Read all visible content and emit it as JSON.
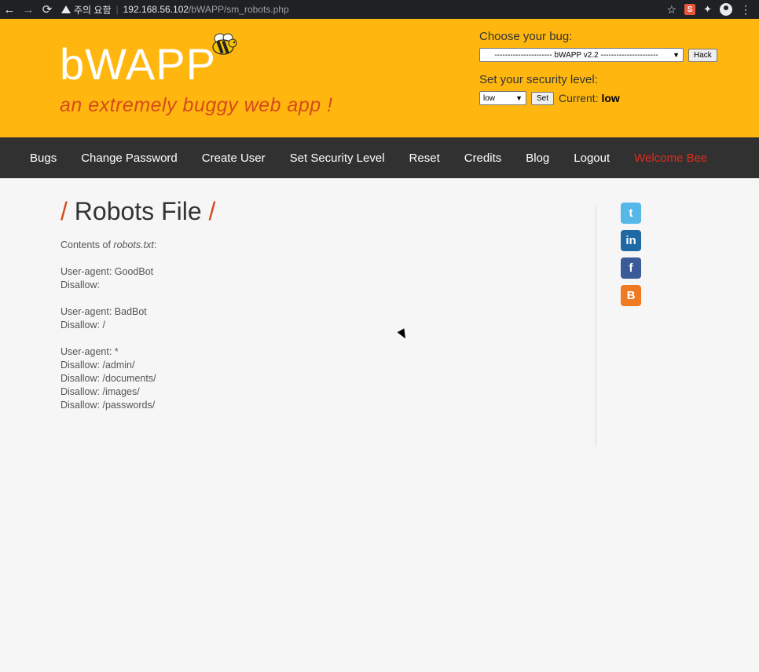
{
  "browser": {
    "warning_label": "주의 요함",
    "url_host": "192.168.56.102",
    "url_path": "/bWAPP/sm_robots.php"
  },
  "header": {
    "logo": "bWAPP",
    "tagline": "an extremely buggy web app !",
    "choose_bug_label": "Choose your bug:",
    "bug_select_value": "---------------------- bWAPP v2.2 ----------------------",
    "hack_button": "Hack",
    "security_label": "Set your security level:",
    "security_select_value": "low",
    "set_button": "Set",
    "current_label": "Current:",
    "current_value": "low",
    "colors": {
      "header_bg": "#ffb70f",
      "accent": "#d64a1a",
      "menu_bg": "#313131",
      "welcome": "#e32b1c"
    }
  },
  "menu": {
    "items": [
      "Bugs",
      "Change Password",
      "Create User",
      "Set Security Level",
      "Reset",
      "Credits",
      "Blog",
      "Logout"
    ],
    "welcome": "Welcome Bee"
  },
  "main": {
    "title": "Robots File",
    "title_slash": "/",
    "intro_prefix": "Contents of ",
    "intro_file": "robots.txt",
    "intro_suffix": ":",
    "lines": [
      "",
      "User-agent: GoodBot",
      "Disallow:",
      "",
      "User-agent: BadBot",
      "Disallow: /",
      "",
      "User-agent: *",
      "Disallow: /admin/",
      "Disallow: /documents/",
      "Disallow: /images/",
      "Disallow: /passwords/"
    ]
  },
  "social": [
    "twitter-icon",
    "linkedin-icon",
    "facebook-icon",
    "blogger-icon"
  ]
}
